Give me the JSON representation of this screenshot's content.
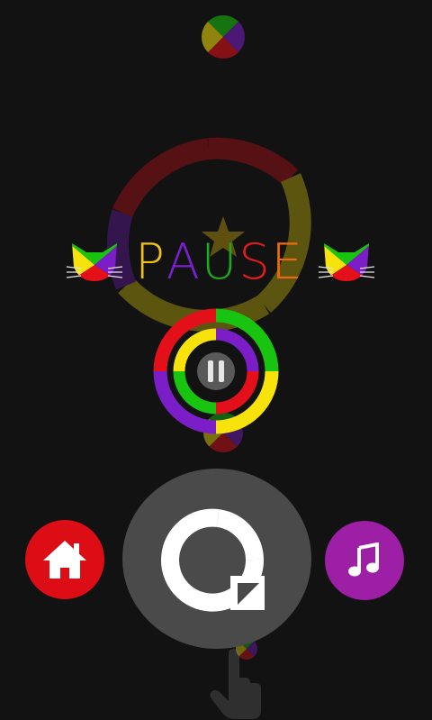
{
  "title_letters": [
    {
      "char": "P",
      "color": "#f2c40f"
    },
    {
      "char": "A",
      "color": "#7a1fd0"
    },
    {
      "char": "U",
      "color": "#1ea81e"
    },
    {
      "char": "S",
      "color": "#e01c1c"
    },
    {
      "char": "E",
      "color": "#f06a0c"
    }
  ],
  "colors": {
    "background": "#121212",
    "yellow": "#f7e20c",
    "purple": "#7b1ec8",
    "green": "#18c40f",
    "red": "#e3101a",
    "home_button": "#dd0d16",
    "music_button": "#9c1fa5",
    "restart_button": "#4a4a4a",
    "pause_center": "#595959"
  },
  "icons": {
    "home": "home-icon",
    "music": "music-note-icon",
    "restart": "restart-icon",
    "pause": "pause-icon",
    "hand": "pointing-hand-icon",
    "cat": "cat-face-icon",
    "star": "star-icon"
  }
}
